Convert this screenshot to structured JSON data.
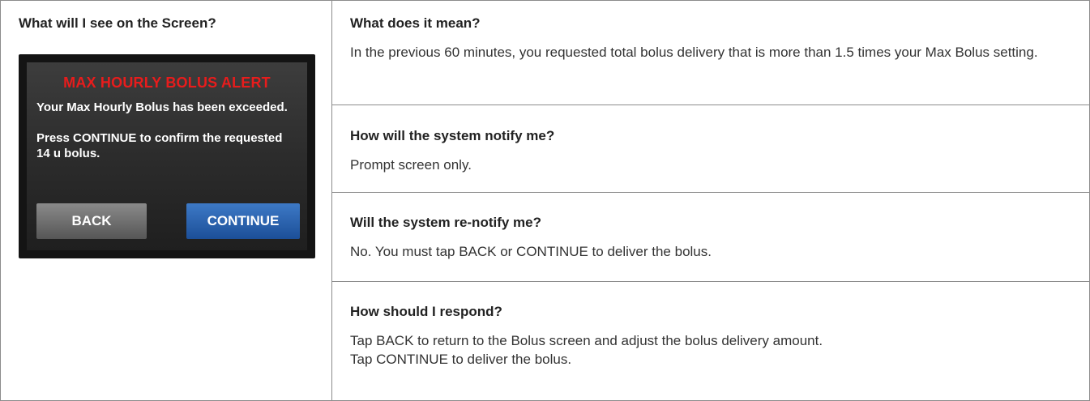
{
  "left": {
    "heading": "What will I see on the Screen?",
    "device": {
      "title": "MAX HOURLY BOLUS ALERT",
      "message_line1": "Your Max Hourly Bolus has been exceeded.",
      "message_line2": "Press CONTINUE to confirm the requested 14 u bolus.",
      "back_label": "BACK",
      "continue_label": "CONTINUE",
      "title_color": "#e81c1c",
      "continue_color": "#2a62b0"
    }
  },
  "rows": [
    {
      "heading": "What does it mean?",
      "text": "In the previous 60 minutes, you requested total bolus delivery that is more than 1.5 times your Max Bolus setting."
    },
    {
      "heading": "How will the system notify me?",
      "text": "Prompt screen only."
    },
    {
      "heading": "Will the system re-notify me?",
      "text": "No. You must tap BACK or CONTINUE to deliver the bolus."
    },
    {
      "heading": "How should I respond?",
      "text_line1": "Tap BACK to return to the Bolus screen and adjust the bolus delivery amount.",
      "text_line2": "Tap CONTINUE to deliver the bolus."
    }
  ]
}
